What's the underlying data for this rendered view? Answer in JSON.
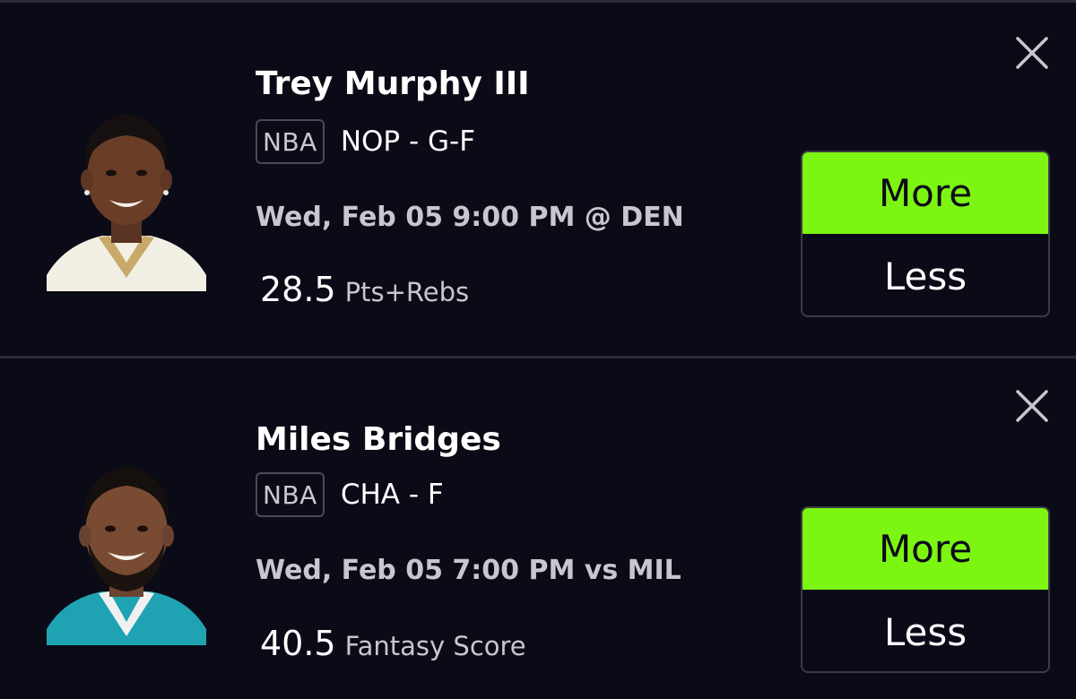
{
  "colors": {
    "background": "#0b0b17",
    "divider": "#2a2b36",
    "more_accent": "#7cf513",
    "secondary_text": "#c6c7cf"
  },
  "projections": [
    {
      "player_name": "Trey Murphy III",
      "league": "NBA",
      "team_position": "NOP - G-F",
      "game_time": "Wed, Feb 05 9:00 PM @ DEN",
      "line_value": "28.5",
      "stat_type": "Pts+Rebs",
      "more_label": "More",
      "less_label": "Less",
      "selected": "More",
      "close_icon": "close-icon",
      "avatar_icon": "player-headshot"
    },
    {
      "player_name": "Miles Bridges",
      "league": "NBA",
      "team_position": "CHA - F",
      "game_time": "Wed, Feb 05 7:00 PM vs MIL",
      "line_value": "40.5",
      "stat_type": "Fantasy Score",
      "more_label": "More",
      "less_label": "Less",
      "selected": "More",
      "close_icon": "close-icon",
      "avatar_icon": "player-headshot"
    }
  ]
}
